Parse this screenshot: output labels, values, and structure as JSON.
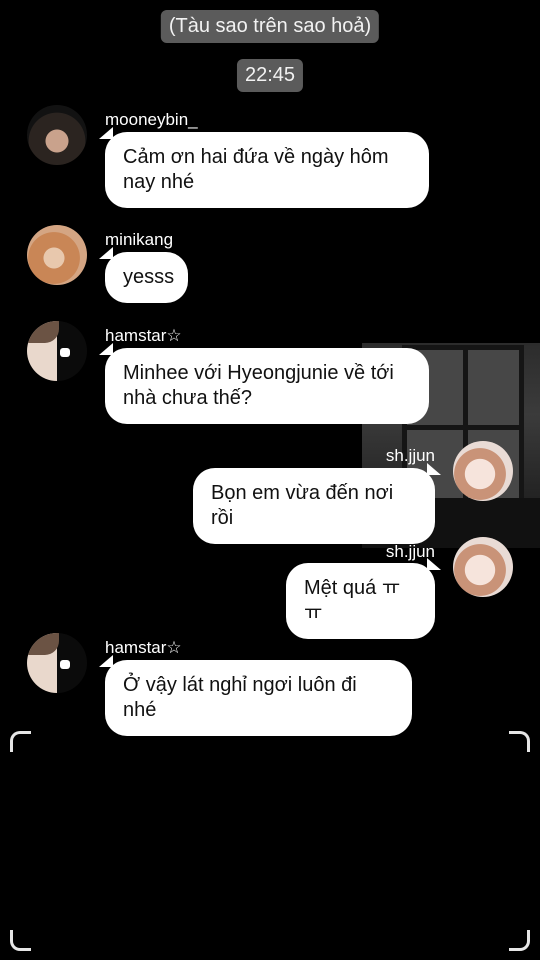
{
  "header": {
    "chat_title": "(Tàu sao trên sao hoả)",
    "time": "22:45"
  },
  "messages": [
    {
      "sender": "mooneybin_",
      "text": "Cảm ơn hai đứa về ngày hôm nay nhé",
      "side": "left"
    },
    {
      "sender": "minikang",
      "text": "yesss",
      "side": "left"
    },
    {
      "sender": "hamstar☆",
      "text": "Minhee với Hyeongjunie về tới nhà chưa thế?",
      "side": "left"
    },
    {
      "sender": "sh.jjun",
      "text": "Bọn em vừa đến nơi rồi",
      "side": "right"
    },
    {
      "sender": "sh.jjun",
      "text": "Mệt quá ㅠㅠ",
      "side": "right"
    },
    {
      "sender": "hamstar☆",
      "text": "Ở vậy lát nghỉ ngơi luôn đi nhé",
      "side": "left"
    }
  ],
  "icons": {
    "avatars": [
      "mooneybin-avatar",
      "minikang-avatar",
      "hamstar-avatar",
      "shjjun-avatar"
    ],
    "frame": "viewfinder-corner-icon"
  },
  "colors": {
    "background": "#000000",
    "bubble": "#ffffff",
    "pill": "#5b5b5b"
  }
}
